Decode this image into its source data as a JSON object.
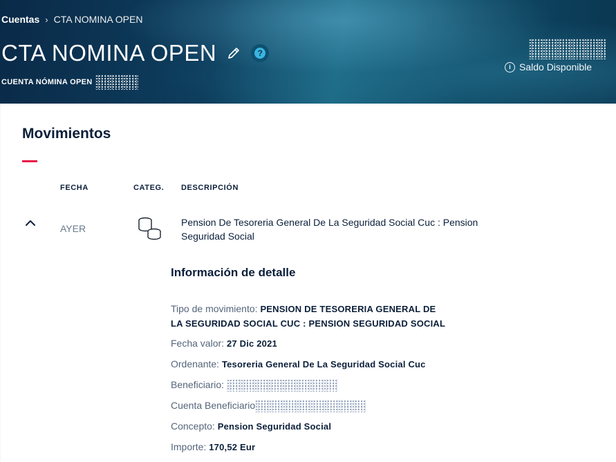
{
  "breadcrumb": {
    "root": "Cuentas",
    "separator": "›",
    "current": "CTA NOMINA OPEN"
  },
  "header": {
    "title": "CTA NOMINA OPEN",
    "subtitle": "CUENTA NÓMINA OPEN",
    "help_glyph": "?",
    "balance_label": "Saldo Disponible",
    "info_glyph": "i"
  },
  "movements": {
    "title": "Movimientos",
    "columns": [
      "FECHA",
      "CATEG.",
      "DESCRIPCIÓN"
    ],
    "row": {
      "date": "AYER",
      "category_icon": "coins-icon",
      "description": "Pension De Tesoreria General De La Seguridad Social Cuc : Pension Seguridad Social"
    }
  },
  "detail": {
    "title": "Información de detalle",
    "tipo_label": "Tipo de movimiento:",
    "tipo_value_1": "PENSION DE TESORERIA GENERAL DE",
    "tipo_value_2": "LA SEGURIDAD SOCIAL CUC : PENSION SEGURIDAD SOCIAL",
    "fecha_label": "Fecha valor:",
    "fecha_value": "27 Dic 2021",
    "ordenante_label": "Ordenante:",
    "ordenante_value": "Tesoreria General De La Seguridad Social Cuc",
    "beneficiario_label": "Beneficiario:",
    "cuenta_label": "Cuenta Beneficiario",
    "concepto_label": "Concepto:",
    "concepto_value": "Pension Seguridad Social",
    "importe_label": "Importe:",
    "importe_value": "170,52 Eur"
  },
  "colors": {
    "accent": "#e8174b",
    "navy": "#0b1f3a",
    "help_badge": "#39b5e0"
  }
}
